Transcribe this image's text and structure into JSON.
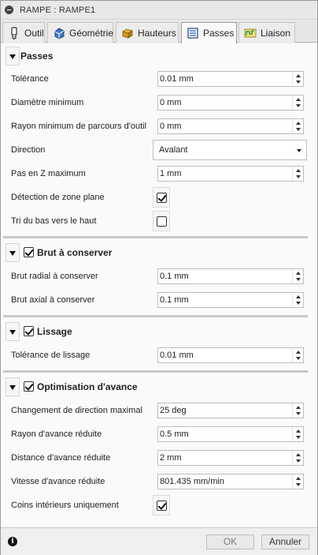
{
  "window": {
    "title": "RAMPE : RAMPE1"
  },
  "tabs": [
    {
      "label": "Outil",
      "icon": "tool-icon"
    },
    {
      "label": "Géométrie",
      "icon": "geometry-icon"
    },
    {
      "label": "Hauteurs",
      "icon": "heights-icon"
    },
    {
      "label": "Passes",
      "icon": "passes-icon",
      "active": true
    },
    {
      "label": "Liaison",
      "icon": "linking-icon"
    }
  ],
  "passes": {
    "title": "Passes",
    "tolerance": {
      "label": "Tolérance",
      "value": "0.01 mm"
    },
    "min_diameter": {
      "label": "Diamètre minimum",
      "value": "0 mm"
    },
    "min_radius": {
      "label": "Rayon minimum de parcours d'outil",
      "value": "0 mm"
    },
    "direction": {
      "label": "Direction",
      "value": "Avalant"
    },
    "max_stepdown": {
      "label": "Pas en Z maximum",
      "value": "1 mm"
    },
    "flat_detection": {
      "label": "Détection de zone plane",
      "checked": true
    },
    "bottom_up": {
      "label": "Tri du bas vers le haut",
      "checked": false
    }
  },
  "stock_to_leave": {
    "title": "Brut à conserver",
    "checked": true,
    "radial": {
      "label": "Brut radial à conserver",
      "value": "0.1 mm"
    },
    "axial": {
      "label": "Brut axial à conserver",
      "value": "0.1 mm"
    }
  },
  "smoothing": {
    "title": "Lissage",
    "checked": true,
    "tolerance": {
      "label": "Tolérance de lissage",
      "value": "0.01 mm"
    }
  },
  "feed_optimization": {
    "title": "Optimisation d'avance",
    "checked": true,
    "max_direction_change": {
      "label": "Changement de direction maximal",
      "value": "25 deg"
    },
    "reduced_feed_radius": {
      "label": "Rayon d'avance réduite",
      "value": "0.5 mm"
    },
    "reduced_feed_distance": {
      "label": "Distance d'avance réduite",
      "value": "2 mm"
    },
    "reduced_feedrate": {
      "label": "Vitesse d'avance réduite",
      "value": "801.435 mm/min"
    },
    "inner_corners_only": {
      "label": "Coins intérieurs uniquement",
      "checked": true
    }
  },
  "footer": {
    "ok_label": "OK",
    "cancel_label": "Annuler"
  },
  "colors": {
    "accent_blue": "#3f78c9",
    "accent_yellow": "#e8b83a",
    "accent_green": "#2e9a55"
  }
}
